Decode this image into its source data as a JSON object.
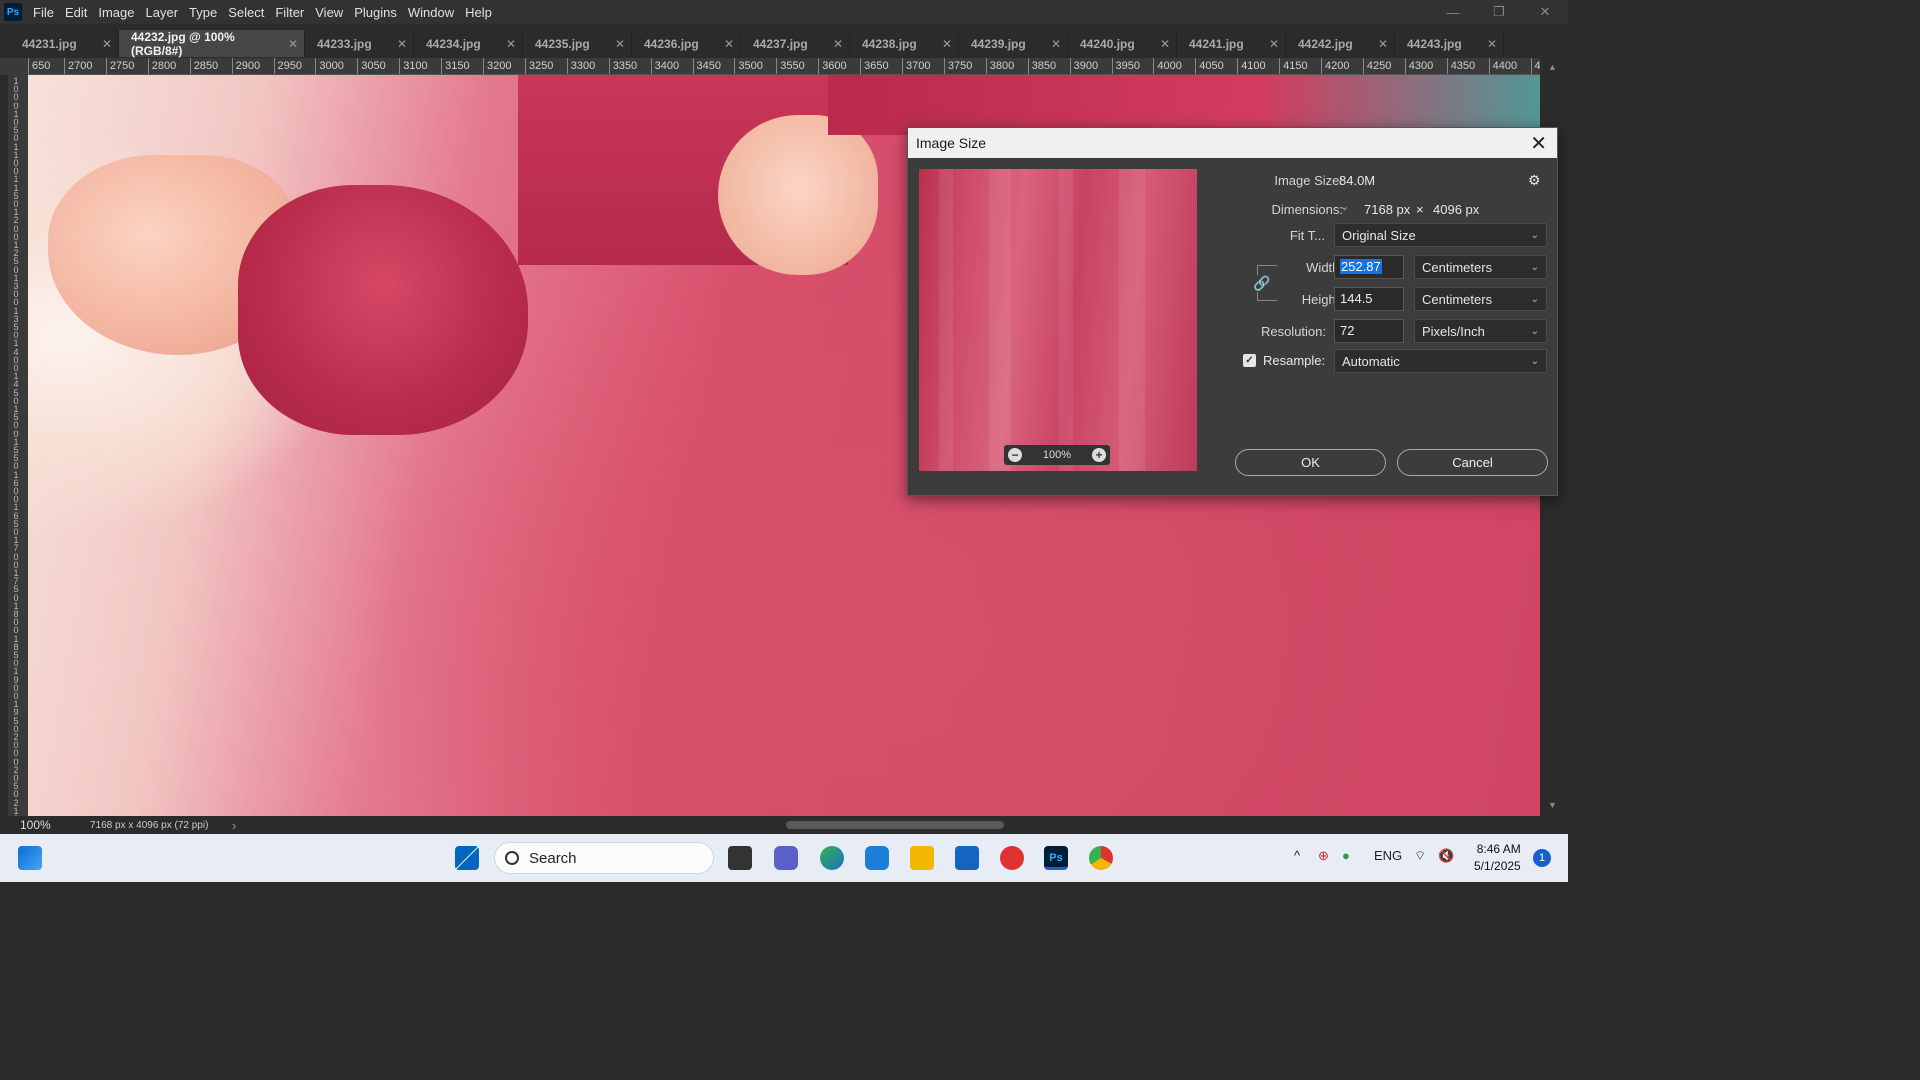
{
  "app": {
    "logo": "Ps",
    "menu": [
      "File",
      "Edit",
      "Image",
      "Layer",
      "Type",
      "Select",
      "Filter",
      "View",
      "Plugins",
      "Window",
      "Help"
    ],
    "window_controls": {
      "minimize": "—",
      "restore": "❐",
      "close": "✕"
    }
  },
  "tabs": [
    {
      "label": "44231.jpg",
      "active": false
    },
    {
      "label": "44232.jpg @ 100% (RGB/8#)",
      "active": true
    },
    {
      "label": "44233.jpg",
      "active": false
    },
    {
      "label": "44234.jpg",
      "active": false
    },
    {
      "label": "44235.jpg",
      "active": false
    },
    {
      "label": "44236.jpg",
      "active": false
    },
    {
      "label": "44237.jpg",
      "active": false
    },
    {
      "label": "44238.jpg",
      "active": false
    },
    {
      "label": "44239.jpg",
      "active": false
    },
    {
      "label": "44240.jpg",
      "active": false
    },
    {
      "label": "44241.jpg",
      "active": false
    },
    {
      "label": "44242.jpg",
      "active": false
    },
    {
      "label": "44243.jpg",
      "active": false
    }
  ],
  "ruler": {
    "horizontal": [
      "650",
      "2700",
      "2750",
      "2800",
      "2850",
      "2900",
      "2950",
      "3000",
      "3050",
      "3100",
      "3150",
      "3200",
      "3250",
      "3300",
      "3350",
      "3400",
      "3450",
      "3500",
      "3550",
      "3600",
      "3650",
      "3700",
      "3750",
      "3800",
      "3850",
      "3900",
      "3950",
      "4000",
      "4050",
      "4100",
      "4150",
      "4200",
      "4250",
      "4300",
      "4350",
      "4400",
      "4450",
      "4"
    ],
    "vertical": [
      "1",
      "0",
      "0",
      "0",
      "1",
      "0",
      "5",
      "0",
      "1",
      "1",
      "0",
      "0",
      "1",
      "1",
      "5",
      "0",
      "1",
      "2",
      "0",
      "0",
      "1",
      "2",
      "5",
      "0",
      "1",
      "3",
      "0",
      "0",
      "1",
      "3",
      "5",
      "0",
      "1",
      "4",
      "0",
      "0",
      "1",
      "4",
      "5",
      "0",
      "1",
      "5",
      "0",
      "0",
      "1",
      "5",
      "5",
      "0",
      "1",
      "6",
      "0",
      "0",
      "1",
      "6",
      "5",
      "0",
      "1",
      "7",
      "0",
      "0",
      "1",
      "7",
      "5",
      "0",
      "1",
      "8",
      "0",
      "0",
      "1",
      "8",
      "5",
      "0",
      "1",
      "9",
      "0",
      "0",
      "1",
      "9",
      "5",
      "0",
      "2",
      "0",
      "0",
      "0",
      "2",
      "0",
      "5",
      "0",
      "2",
      "1",
      "0",
      "0",
      "2",
      "1",
      "5",
      "0",
      "2",
      "2",
      "0",
      "0",
      "2",
      "2",
      "5",
      "0",
      "2",
      "3",
      "0",
      "0",
      "2",
      "3",
      "5",
      "0",
      "2",
      "4",
      "0",
      "0",
      "2",
      "4",
      "5",
      "0"
    ]
  },
  "status": {
    "zoom": "100%",
    "doc_info": "7168 px x 4096 px (72 ppi)",
    "arrow": "›"
  },
  "dialog": {
    "title": "Image Size",
    "close": "✕",
    "image_size_label": "Image Size:",
    "image_size_value": "84.0M",
    "gear": "⚙",
    "dimensions_label": "Dimensions:",
    "dimensions_width": "7168 px",
    "dimensions_x": "×",
    "dimensions_height": "4096 px",
    "fit_to_label": "Fit T...",
    "fit_to_value": "Original Size",
    "width_label": "Width:",
    "width_value": "252.87",
    "width_unit": "Centimeters",
    "height_label": "Height:",
    "height_value": "144.5",
    "height_unit": "Centimeters",
    "resolution_label": "Resolution:",
    "resolution_value": "72",
    "resolution_unit": "Pixels/Inch",
    "resample_label": "Resample:",
    "resample_checked": true,
    "resample_value": "Automatic",
    "preview_zoom": "100%",
    "zoom_out": "−",
    "zoom_in": "+",
    "ok": "OK",
    "cancel": "Cancel"
  },
  "taskbar": {
    "search_label": "Search",
    "language": "ENG",
    "time": "8:46 AM",
    "date": "5/1/2025",
    "notifications": "1",
    "tray_chevron": "^"
  }
}
